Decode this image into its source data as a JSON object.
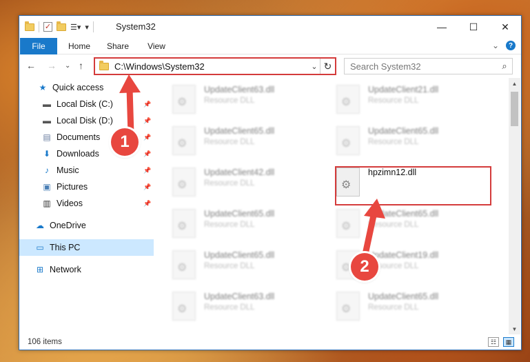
{
  "window": {
    "title": "System32",
    "controls": {
      "minimize": "—",
      "maximize": "☐",
      "close": "✕"
    }
  },
  "ribbon": {
    "tabs": [
      "File",
      "Home",
      "Share",
      "View"
    ],
    "collapse_glyph": "⌄",
    "help_glyph": "?"
  },
  "address": {
    "path": "C:\\Windows\\System32",
    "search_placeholder": "Search System32"
  },
  "nav": {
    "items": [
      {
        "label": "Quick access",
        "icon": "star-icon"
      },
      {
        "label": "Local Disk (C:)",
        "icon": "drive-icon",
        "pinned": true
      },
      {
        "label": "Local Disk (D:)",
        "icon": "drive-icon",
        "pinned": true
      },
      {
        "label": "Documents",
        "icon": "documents-icon",
        "pinned": true
      },
      {
        "label": "Downloads",
        "icon": "download-icon",
        "pinned": true
      },
      {
        "label": "Music",
        "icon": "music-icon",
        "pinned": true
      },
      {
        "label": "Pictures",
        "icon": "pictures-icon",
        "pinned": true
      },
      {
        "label": "Videos",
        "icon": "videos-icon",
        "pinned": true
      },
      {
        "label": "OneDrive",
        "icon": "cloud-icon"
      },
      {
        "label": "This PC",
        "icon": "computer-icon",
        "selected": true
      },
      {
        "label": "Network",
        "icon": "network-icon"
      }
    ]
  },
  "files": [
    {
      "name": "UpdateClient63.dll",
      "type": "Resource DLL",
      "blurred": true
    },
    {
      "name": "UpdateClient21.dll",
      "type": "Resource DLL",
      "blurred": true
    },
    {
      "name": "UpdateClient65.dll",
      "type": "Resource DLL",
      "blurred": true
    },
    {
      "name": "UpdateClient65.dll",
      "type": "Resource DLL",
      "blurred": true
    },
    {
      "name": "UpdateClient42.dll",
      "type": "Resource DLL",
      "blurred": true
    },
    {
      "name": "hpzimn12.dll",
      "type": "",
      "blurred": false
    },
    {
      "name": "UpdateClient65.dll",
      "type": "Resource DLL",
      "blurred": true
    },
    {
      "name": "UpdateClient65.dll",
      "type": "Resource DLL",
      "blurred": true
    },
    {
      "name": "UpdateClient65.dll",
      "type": "Resource DLL",
      "blurred": true
    },
    {
      "name": "UpdateClient19.dll",
      "type": "Resource DLL",
      "blurred": true
    },
    {
      "name": "UpdateClient63.dll",
      "type": "Resource DLL",
      "blurred": true
    },
    {
      "name": "UpdateClient65.dll",
      "type": "Resource DLL",
      "blurred": true
    }
  ],
  "status": {
    "item_count": "106 items"
  },
  "callouts": {
    "step1": "1",
    "step2": "2"
  },
  "colors": {
    "accent": "#1979ca",
    "highlight": "#d43b3b",
    "badge": "#e8473f"
  }
}
